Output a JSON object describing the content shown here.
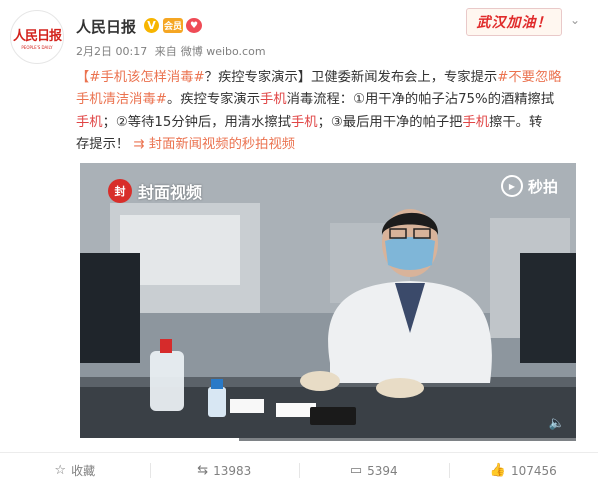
{
  "header": {
    "avatar_logo": "人民日报",
    "avatar_logo_sub": "PEOPLE'S DAILY",
    "account_name": "人民日报",
    "verified_badge": "V",
    "vip_badge": "会员",
    "time": "2月2日 00:17",
    "source_prefix": "来自",
    "source": "微博 weibo.com",
    "stamp": "武汉加油！",
    "menu_icon": "chevron-down-icon"
  },
  "post": {
    "line1": {
      "tag1": "【#手机该怎样消毒#",
      "t1": "？疾控专家演示】卫健委新闻发布会上，专家提示",
      "tag2": "#不要忽略"
    },
    "line2": {
      "tag2b": "手机清洁消毒#",
      "t1": "。疾控专家演示",
      "hl1": "手机",
      "t2": "消毒流程：①用干净的帕子沾75%的酒精擦拭"
    },
    "line3": {
      "hl1": "手机",
      "t1": "；②等待15分钟后，用清水擦拭",
      "hl2": "手机",
      "t2": "；③最后用干净的帕子把",
      "hl3": "手机",
      "t3": "擦干。转"
    },
    "line4": {
      "t1": "存提示！",
      "video_link": "封面新闻视频的秒拍视频"
    }
  },
  "video": {
    "brand": "封面视频",
    "brand_icon": "封",
    "watermark": "秒拍",
    "progress": 0.32
  },
  "actions": {
    "favorite": "收藏",
    "repost": "13983",
    "comment": "5394",
    "like": "107456"
  }
}
